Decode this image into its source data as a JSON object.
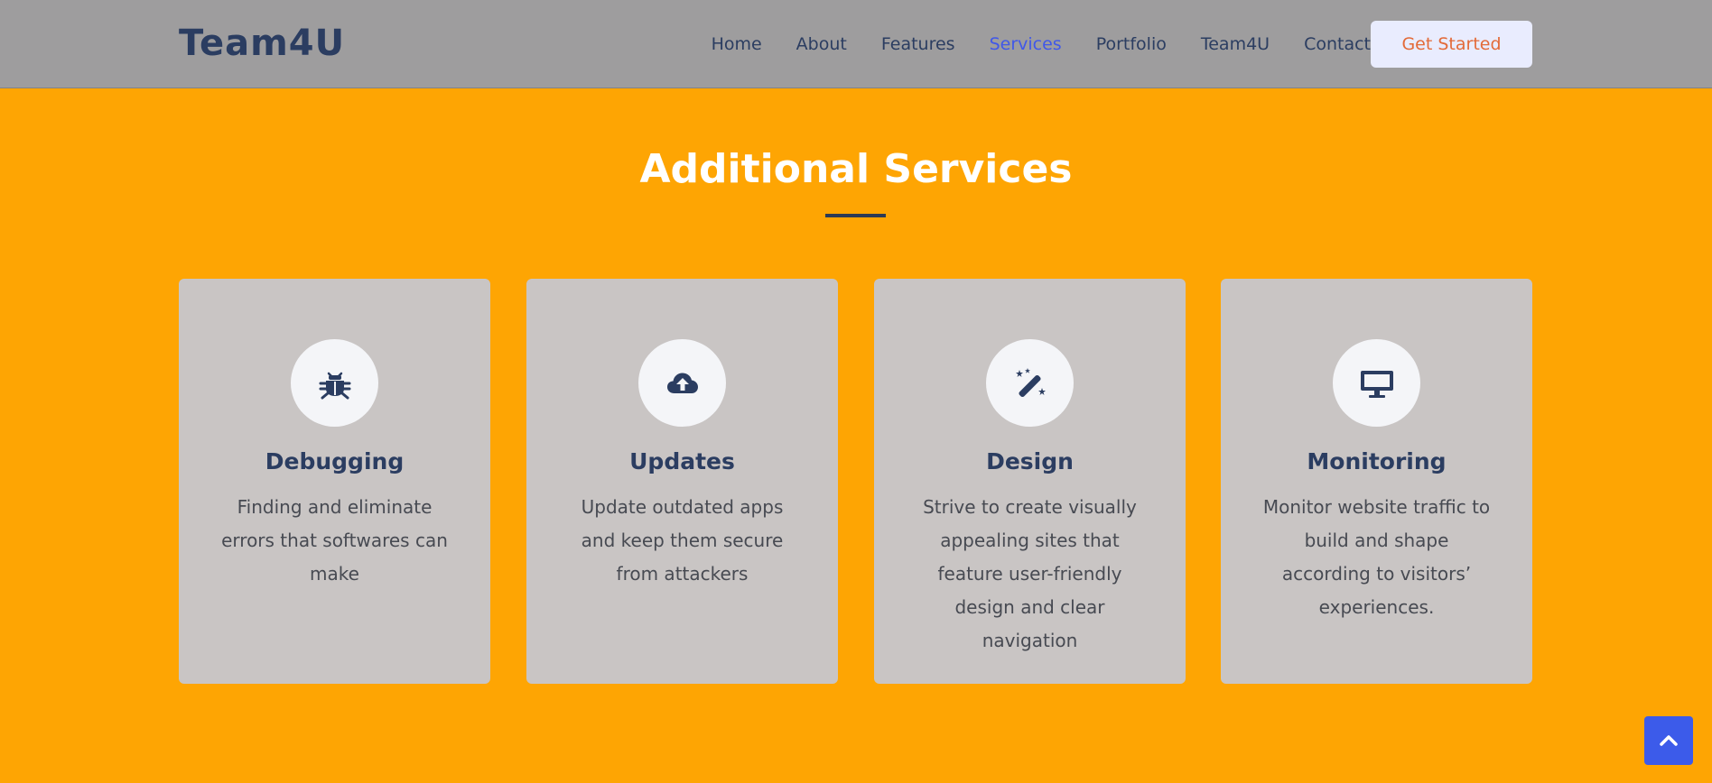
{
  "header": {
    "brand": "Team4U",
    "nav": [
      {
        "label": "Home"
      },
      {
        "label": "About"
      },
      {
        "label": "Features"
      },
      {
        "label": "Services"
      },
      {
        "label": "Portfolio"
      },
      {
        "label": "Team4U"
      },
      {
        "label": "Contact"
      }
    ],
    "active_nav": "Services",
    "cta_label": "Get Started"
  },
  "section": {
    "title": "Additional Services",
    "cards": [
      {
        "icon": "bug-icon",
        "title": "Debugging",
        "description": "Finding and eliminate errors that softwares can make"
      },
      {
        "icon": "cloud-upload-icon",
        "title": "Updates",
        "description": "Update outdated apps and keep them secure from attackers"
      },
      {
        "icon": "magic-wand-icon",
        "title": "Design",
        "description": "Strive to create visually appealing sites that feature user-friendly design and clear navigation"
      },
      {
        "icon": "desktop-icon",
        "title": "Monitoring",
        "description": "Monitor website traffic to build and shape according to visitors’ experiences."
      }
    ]
  },
  "back_to_top_icon": "chevron-up-icon",
  "colors": {
    "background": "#fea503",
    "navbar": "#9e9d9e",
    "card": "#c9c5c4",
    "heading": "#2b3d61",
    "active_link": "#4058e9",
    "cta_text": "#e36a38",
    "back_to_top": "#3c5bea"
  }
}
